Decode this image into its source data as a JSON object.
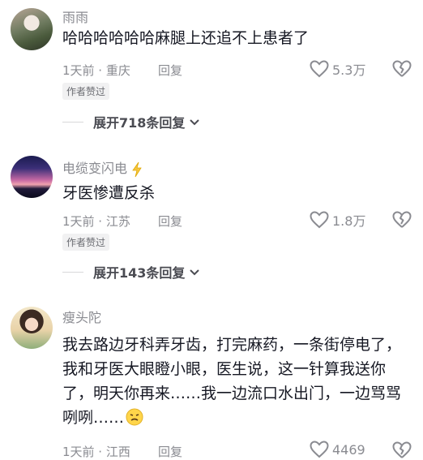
{
  "comments": [
    {
      "username": "雨雨",
      "text": "哈哈哈哈哈哈麻腿上还追不上患者了",
      "meta": "1天前 · 重庆",
      "reply_label": "回复",
      "likes": "5.3万",
      "badge": "作者赞过",
      "expand": "展开718条回复"
    },
    {
      "username": "电缆变闪电",
      "text": "牙医惨遭反杀",
      "meta": "1天前 · 江苏",
      "reply_label": "回复",
      "likes": "1.8万",
      "badge": "作者赞过",
      "expand": "展开143条回复"
    },
    {
      "username": "瘦头陀",
      "text": "我去路边牙科弄牙齿，打完麻药，一条街停电了，我和牙医大眼瞪小眼，医生说，这一针算我送你了，明天你再来……我一边流口水出门，一边骂骂咧咧……",
      "meta": "1天前 · 江西",
      "reply_label": "回复",
      "likes": "4469"
    }
  ],
  "icons": {
    "like": "heart-outline-icon",
    "dislike": "broken-heart-icon",
    "verified": "lightning-icon",
    "expand": "chevron-down-icon",
    "emoji": "awkward-face-emoji-icon"
  }
}
